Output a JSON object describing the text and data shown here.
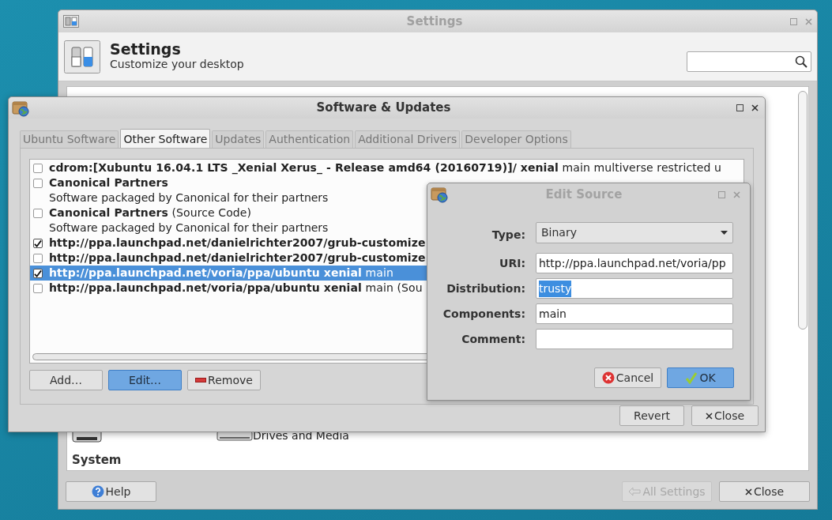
{
  "settings_window": {
    "title": "Settings",
    "heading": "Settings",
    "subtitle": "Customize your desktop",
    "items": [
      {
        "label": "Drives and Media"
      }
    ],
    "section": "System",
    "buttons": [
      {
        "label": "Help",
        "kind": "help",
        "disabled": false
      },
      {
        "label": "All Settings",
        "kind": "back",
        "disabled": true
      },
      {
        "label": "Close",
        "kind": "close",
        "disabled": false
      }
    ]
  },
  "software_window": {
    "title": "Software & Updates",
    "tabs": [
      {
        "label": "Ubuntu Software",
        "selected": false
      },
      {
        "label": "Other Software",
        "selected": true
      },
      {
        "label": "Updates",
        "selected": false
      },
      {
        "label": "Authentication",
        "selected": false
      },
      {
        "label": "Additional Drivers",
        "selected": false
      },
      {
        "label": "Developer Options",
        "selected": false
      }
    ],
    "sources": [
      {
        "text": "**cdrom:[Xubuntu 16.04.1 LTS _Xenial Xerus_ - Release amd64 (20160719)]/ xenial** main multiverse restricted u",
        "checked": false,
        "selected": false
      },
      {
        "text": "**Canonical Partners**",
        "subtitle": "Software packaged by Canonical for their partners",
        "checked": false,
        "selected": false
      },
      {
        "text": "**Canonical Partners** (Source Code)",
        "subtitle": "Software packaged by Canonical for their partners",
        "checked": false,
        "selected": false
      },
      {
        "text": "**http://ppa.launchpad.net/danielrichter2007/grub-customize**",
        "checked": true,
        "selected": false
      },
      {
        "text": "**http://ppa.launchpad.net/danielrichter2007/grub-customize**",
        "checked": false,
        "selected": false
      },
      {
        "text": "**http://ppa.launchpad.net/voria/ppa/ubuntu xenial** main",
        "checked": true,
        "selected": true
      },
      {
        "text": "**http://ppa.launchpad.net/voria/ppa/ubuntu xenial** main (Sou",
        "checked": false,
        "selected": false
      }
    ],
    "list_buttons": [
      {
        "label": "Add…",
        "kind": "plain"
      },
      {
        "label": "Edit…",
        "kind": "focused"
      },
      {
        "label": "Remove",
        "kind": "remove"
      }
    ],
    "footer_buttons": [
      {
        "label": "Revert",
        "kind": "plain"
      },
      {
        "label": "Close",
        "kind": "close"
      }
    ]
  },
  "edit_source": {
    "title": "Edit Source",
    "fields": [
      {
        "label": "Type:",
        "kind": "dropdown",
        "value": "Binary"
      },
      {
        "label": "URI:",
        "kind": "text",
        "value": "http://ppa.launchpad.net/voria/pp",
        "highlighted": false
      },
      {
        "label": "Distribution:",
        "kind": "text",
        "value": "trusty",
        "highlighted": true
      },
      {
        "label": "Components:",
        "kind": "text",
        "value": "main",
        "highlighted": false
      },
      {
        "label": "Comment:",
        "kind": "text"
      }
    ],
    "buttons": [
      {
        "label": "Cancel",
        "kind": "cancel"
      },
      {
        "label": "OK",
        "kind": "ok"
      }
    ]
  }
}
